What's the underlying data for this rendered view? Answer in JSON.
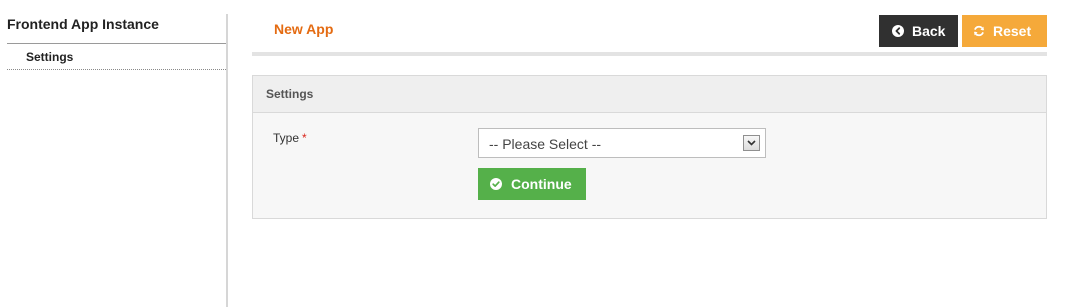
{
  "sidebar": {
    "title": "Frontend App Instance",
    "items": [
      {
        "label": "Settings"
      }
    ]
  },
  "header": {
    "title": "New App",
    "back_label": "Back",
    "reset_label": "Reset",
    "back_icon": "arrow-left-circle-icon",
    "reset_icon": "refresh-icon"
  },
  "panel": {
    "title": "Settings",
    "fields": {
      "type": {
        "label": "Type",
        "required_mark": "*",
        "selected_value": "-- Please Select --"
      }
    },
    "continue_label": "Continue",
    "continue_icon": "check-circle-icon"
  },
  "colors": {
    "page_title": "#e46b12",
    "back_button": "#303030",
    "reset_button": "#f5a93a",
    "continue_button": "#55b04a",
    "required": "#d9261c"
  }
}
